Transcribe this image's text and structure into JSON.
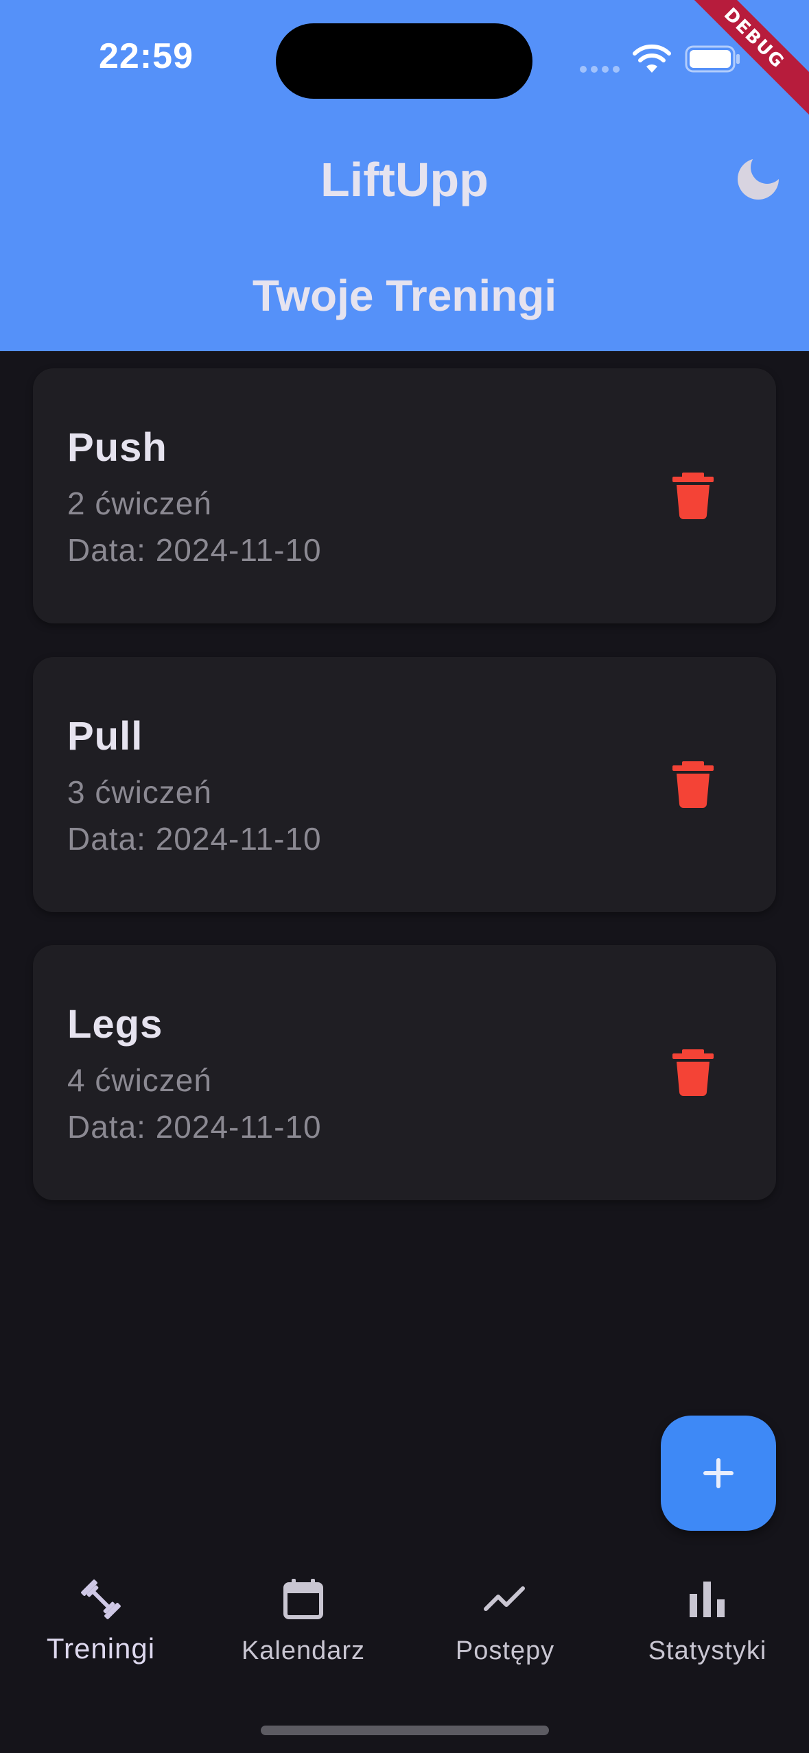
{
  "status_bar": {
    "time": "22:59",
    "icons": [
      "cellular-signal-icon",
      "wifi-icon",
      "battery-icon"
    ]
  },
  "debug_banner": "DEBUG",
  "app_bar": {
    "title": "LiftUpp",
    "theme_toggle_icon": "moon-icon"
  },
  "page": {
    "title": "Twoje Treningi"
  },
  "workouts": [
    {
      "name": "Push",
      "exercise_count": "2 ćwiczeń",
      "date": "Data: 2024-11-10",
      "delete_icon": "trash-icon"
    },
    {
      "name": "Pull",
      "exercise_count": "3 ćwiczeń",
      "date": "Data: 2024-11-10",
      "delete_icon": "trash-icon"
    },
    {
      "name": "Legs",
      "exercise_count": "4 ćwiczeń",
      "date": "Data: 2024-11-10",
      "delete_icon": "trash-icon"
    }
  ],
  "fab": {
    "icon": "plus-icon"
  },
  "bottom_nav": {
    "active_index": 0,
    "items": [
      {
        "label": "Treningi",
        "icon": "dumbbell-icon"
      },
      {
        "label": "Kalendarz",
        "icon": "calendar-icon"
      },
      {
        "label": "Postępy",
        "icon": "trending-up-icon"
      },
      {
        "label": "Statystyki",
        "icon": "bar-chart-icon"
      }
    ]
  },
  "colors": {
    "header": "#5591f9",
    "background": "#15141a",
    "card": "#1f1e23",
    "delete": "#f44336",
    "fab": "#3e89f6",
    "title_text": "#e6e3ef",
    "secondary_text": "#8b8992"
  }
}
